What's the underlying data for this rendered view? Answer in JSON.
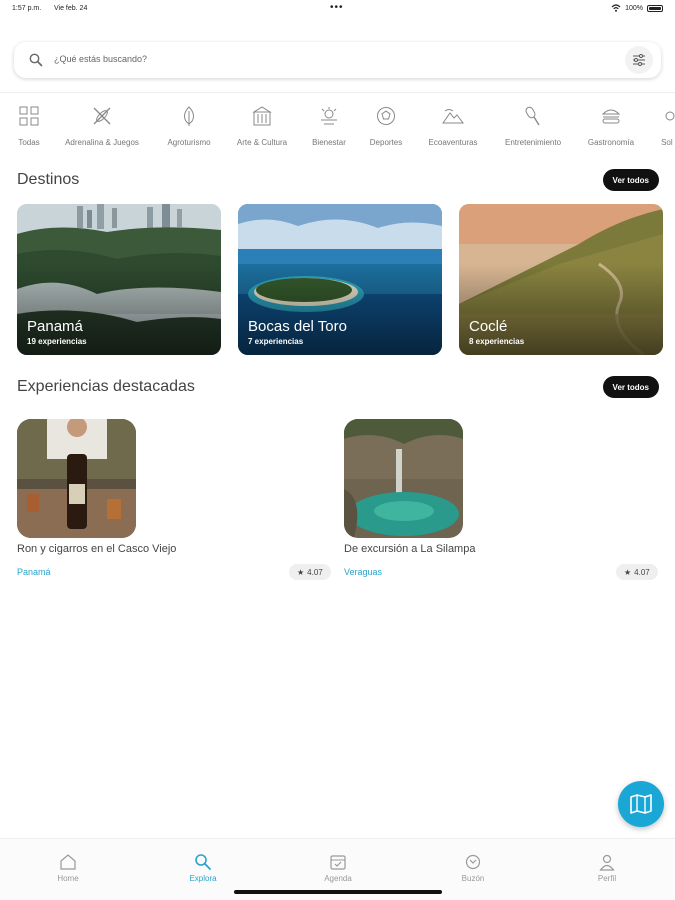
{
  "status_bar": {
    "time": "1:57 p.m.",
    "date": "Vie feb. 24",
    "dots": "•••",
    "battery": "100%"
  },
  "search": {
    "placeholder": "¿Qué estás buscando?"
  },
  "categories": [
    {
      "label": "Todas",
      "icon": "grid-icon"
    },
    {
      "label": "Adrenalina & Juegos",
      "icon": "kayak-icon"
    },
    {
      "label": "Agroturismo",
      "icon": "leaf-icon"
    },
    {
      "label": "Arte & Cultura",
      "icon": "building-icon"
    },
    {
      "label": "Bienestar",
      "icon": "spa-icon"
    },
    {
      "label": "Deportes",
      "icon": "ball-icon"
    },
    {
      "label": "Ecoaventuras",
      "icon": "mountain-icon"
    },
    {
      "label": "Entretenimiento",
      "icon": "music-icon"
    },
    {
      "label": "Gastronomía",
      "icon": "burger-icon"
    },
    {
      "label": "Sol y",
      "icon": "sun-icon"
    }
  ],
  "destinos": {
    "title": "Destinos",
    "see_all": "Ver todos",
    "items": [
      {
        "name": "Panamá",
        "count": "19 experiencias"
      },
      {
        "name": "Bocas del Toro",
        "count": "7 experiencias"
      },
      {
        "name": "Coclé",
        "count": "8 experiencias"
      }
    ]
  },
  "experiencias": {
    "title": "Experiencias destacadas",
    "see_all": "Ver todos",
    "items": [
      {
        "title": "Ron y cigarros en el Casco Viejo",
        "location": "Panamá",
        "rating": "4.07"
      },
      {
        "title": "De excursión a La Silampa",
        "location": "Veraguas",
        "rating": "4.07"
      }
    ]
  },
  "tabs": [
    {
      "label": "Home",
      "icon": "home-icon"
    },
    {
      "label": "Explora",
      "icon": "search-icon",
      "active": true
    },
    {
      "label": "Agenda",
      "icon": "calendar-icon"
    },
    {
      "label": "Buzón",
      "icon": "mailbox-icon"
    },
    {
      "label": "Perfil",
      "icon": "user-icon"
    }
  ],
  "colors": {
    "accent": "#29a3cc",
    "fab": "#1aa7d6",
    "pill": "#111111"
  }
}
